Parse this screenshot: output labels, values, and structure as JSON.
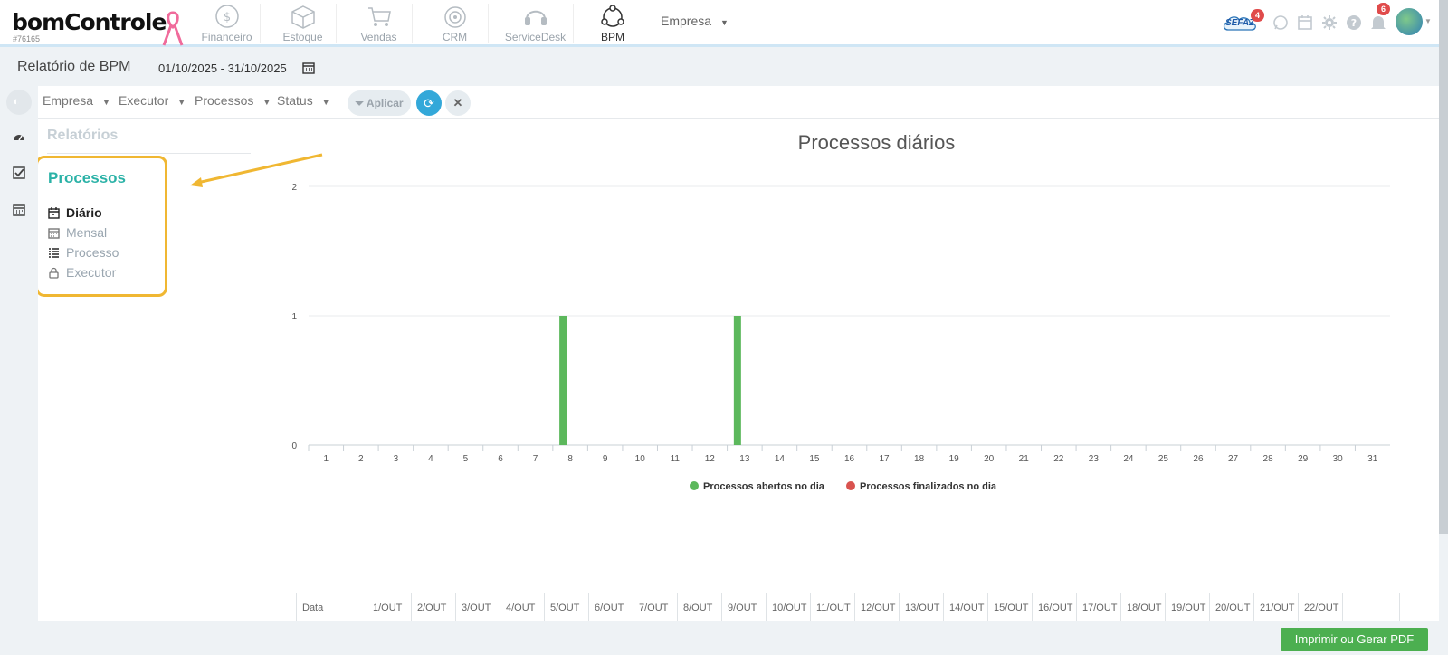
{
  "brand": {
    "logo_text": "bomControle",
    "account_id": "#76165"
  },
  "modules": [
    {
      "label": "Financeiro",
      "icon": "dollar-coin-icon"
    },
    {
      "label": "Estoque",
      "icon": "box-icon"
    },
    {
      "label": "Vendas",
      "icon": "cart-icon"
    },
    {
      "label": "CRM",
      "icon": "target-icon"
    },
    {
      "label": "ServiceDesk",
      "icon": "headset-icon"
    },
    {
      "label": "BPM",
      "icon": "bpm-network-icon"
    }
  ],
  "top_empresa": "Empresa",
  "top_right": {
    "sefaz_label": "SEFAZ",
    "sefaz_badge": "4",
    "notif_badge": "6"
  },
  "report": {
    "title": "Relatório de BPM",
    "date_range": "01/10/2025 - 31/10/2025"
  },
  "filters": {
    "empresa": "Empresa",
    "executor": "Executor",
    "processos": "Processos",
    "status": "Status",
    "aplicar": "Aplicar"
  },
  "sidebar": {
    "section": "Relatórios",
    "group": "Processos",
    "items": [
      {
        "label": "Diário",
        "icon": "calendar-day-icon",
        "active": true
      },
      {
        "label": "Mensal",
        "icon": "calendar-icon",
        "active": false
      },
      {
        "label": "Processo",
        "icon": "list-icon",
        "active": false
      },
      {
        "label": "Executor",
        "icon": "lock-icon",
        "active": false
      }
    ]
  },
  "chart_data": {
    "type": "bar",
    "title": "Processos diários",
    "categories": [
      "1",
      "2",
      "3",
      "4",
      "5",
      "6",
      "7",
      "8",
      "9",
      "10",
      "11",
      "12",
      "13",
      "14",
      "15",
      "16",
      "17",
      "18",
      "19",
      "20",
      "21",
      "22",
      "23",
      "24",
      "25",
      "26",
      "27",
      "28",
      "29",
      "30",
      "31"
    ],
    "series": [
      {
        "name": "Processos abertos no dia",
        "color": "#5cb85c",
        "values": [
          0,
          0,
          0,
          0,
          0,
          0,
          0,
          1,
          0,
          0,
          0,
          0,
          1,
          0,
          0,
          0,
          0,
          0,
          0,
          0,
          0,
          0,
          0,
          0,
          0,
          0,
          0,
          0,
          0,
          0,
          0
        ]
      },
      {
        "name": "Processos finalizados no dia",
        "color": "#d9534f",
        "values": [
          0,
          0,
          0,
          0,
          0,
          0,
          0,
          0,
          0,
          0,
          0,
          0,
          0,
          0,
          0,
          0,
          0,
          0,
          0,
          0,
          0,
          0,
          0,
          0,
          0,
          0,
          0,
          0,
          0,
          0,
          0
        ]
      }
    ],
    "ylim": [
      0,
      2
    ],
    "yticks": [
      0,
      1,
      2
    ],
    "grid": true,
    "legend": "bottom"
  },
  "table": {
    "header": [
      "Data",
      "1/OUT",
      "2/OUT",
      "3/OUT",
      "4/OUT",
      "5/OUT",
      "6/OUT",
      "7/OUT",
      "8/OUT",
      "9/OUT",
      "10/OUT",
      "11/OUT",
      "12/OUT",
      "13/OUT",
      "14/OUT",
      "15/OUT",
      "16/OUT",
      "17/OUT",
      "18/OUT",
      "19/OUT",
      "20/OUT",
      "21/OUT",
      "22/OUT"
    ]
  },
  "footer": {
    "pdf_button": "Imprimir ou Gerar PDF"
  }
}
